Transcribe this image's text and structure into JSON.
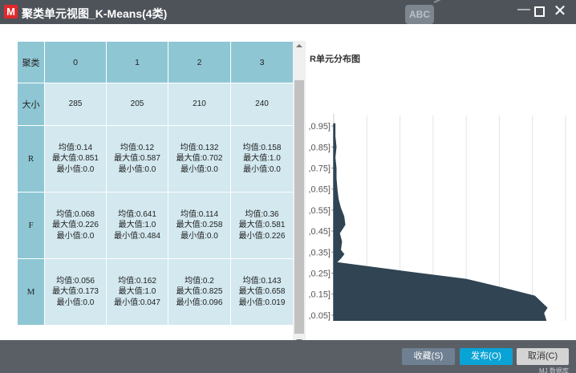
{
  "window": {
    "logo_letter": "M",
    "title": "聚类单元视图_K-Means(4类)",
    "bg_node_label": "ABC"
  },
  "table": {
    "header_label": "聚类",
    "clusters": [
      "0",
      "1",
      "2",
      "3"
    ],
    "size_label": "大小",
    "sizes": [
      "285",
      "205",
      "210",
      "240"
    ],
    "metrics": [
      {
        "name": "R",
        "cells": [
          {
            "mean": "均值:0.14",
            "max": "最大值:0.851",
            "min": "最小值:0.0"
          },
          {
            "mean": "均值:0.12",
            "max": "最大值:0.587",
            "min": "最小值:0.0"
          },
          {
            "mean": "均值:0.132",
            "max": "最大值:0.702",
            "min": "最小值:0.0"
          },
          {
            "mean": "均值:0.158",
            "max": "最大值:1.0",
            "min": "最小值:0.0"
          }
        ]
      },
      {
        "name": "F",
        "cells": [
          {
            "mean": "均值:0.068",
            "max": "最大值:0.226",
            "min": "最小值:0.0"
          },
          {
            "mean": "均值:0.641",
            "max": "最大值:1.0",
            "min": "最小值:0.484"
          },
          {
            "mean": "均值:0.114",
            "max": "最大值:0.258",
            "min": "最小值:0.0"
          },
          {
            "mean": "均值:0.36",
            "max": "最大值:0.581",
            "min": "最小值:0.226"
          }
        ]
      },
      {
        "name": "M",
        "cells": [
          {
            "mean": "均值:0.056",
            "max": "最大值:0.173",
            "min": "最小值:0.0"
          },
          {
            "mean": "均值:0.162",
            "max": "最大值:1.0",
            "min": "最小值:0.047"
          },
          {
            "mean": "均值:0.2",
            "max": "最大值:0.825",
            "min": "最小值:0.096"
          },
          {
            "mean": "均值:0.143",
            "max": "最大值:0.658",
            "min": "最小值:0.019"
          }
        ]
      }
    ]
  },
  "chart_data": {
    "type": "area",
    "title": "R单元分布图",
    "orientation": "horizontal",
    "categories": [
      ",0.05]",
      ",0.15]",
      ",0.25]",
      ",0.35]",
      ",0.45]",
      ",0.55]",
      ",0.65]",
      ",0.75]",
      ",0.85]",
      ",0.95]"
    ],
    "points": [
      [
        0.0,
        198
      ],
      [
        0.01,
        193
      ],
      [
        0.06,
        190
      ],
      [
        0.085,
        193
      ],
      [
        0.14,
        182
      ],
      [
        0.18,
        152
      ],
      [
        0.22,
        120
      ],
      [
        0.26,
        60
      ],
      [
        0.3,
        2
      ],
      [
        0.32,
        6
      ],
      [
        0.34,
        9
      ],
      [
        0.36,
        6
      ],
      [
        0.4,
        7
      ],
      [
        0.44,
        5
      ],
      [
        0.48,
        10
      ],
      [
        0.52,
        9
      ],
      [
        0.56,
        6
      ],
      [
        0.6,
        4
      ],
      [
        0.64,
        3
      ],
      [
        0.7,
        2
      ],
      [
        0.75,
        2
      ],
      [
        0.8,
        1
      ],
      [
        0.85,
        2
      ],
      [
        0.9,
        1
      ],
      [
        0.96,
        1
      ]
    ],
    "xlim": [
      0,
      210
    ],
    "ylim": [
      0,
      1.0
    ],
    "x_ticks": [
      "0",
      "30",
      "60",
      "90",
      "120",
      "150",
      "180",
      "210"
    ],
    "grid": true,
    "fill_color": "#304453"
  },
  "footer": {
    "fav_label": "收藏(S)",
    "publish_label": "发布(O)",
    "cancel_label": "取消(C)",
    "bg_text": "MJ 数据库"
  },
  "colors": {
    "header_cell": "#8fc6d4",
    "data_cell": "#d3e8ef",
    "primary_button": "#0aa3d6",
    "titlebar": "#4e535a"
  }
}
